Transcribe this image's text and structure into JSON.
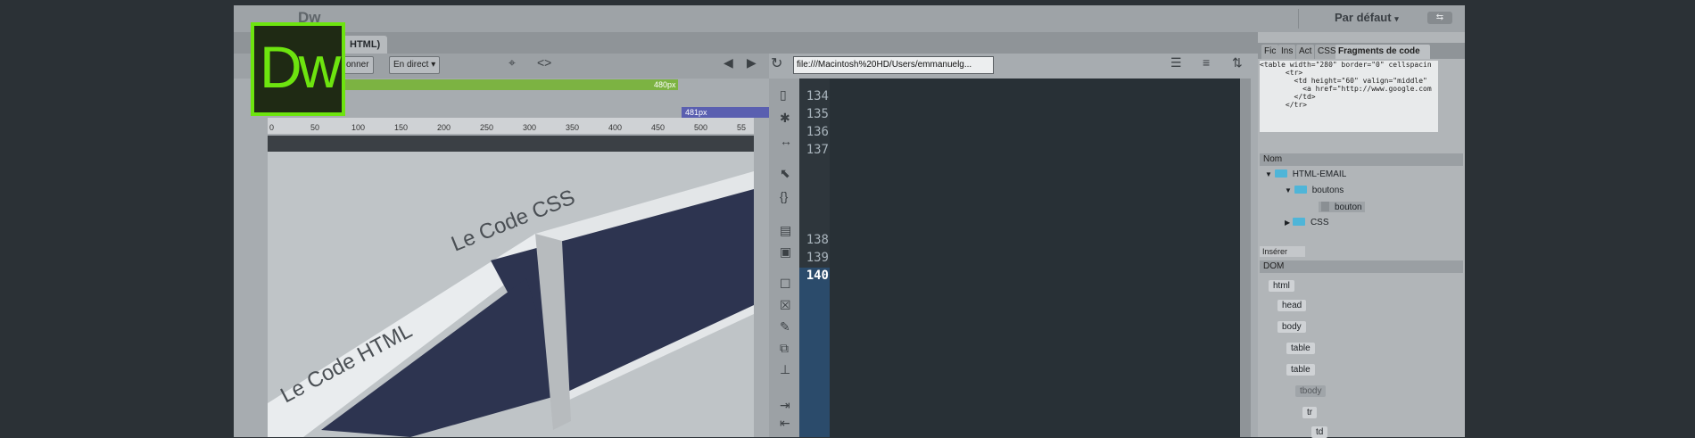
{
  "app": {
    "title": "Dw",
    "workspace": "Par défaut",
    "logo_text": "Dw"
  },
  "document": {
    "tab_label": "HTML)",
    "url": "file:///Macintosh%20HD/Users/emmanuelg...",
    "toolbar_btn1": "onner",
    "toolbar_btn2": "En direct"
  },
  "design_view": {
    "media_queries": [
      "480px",
      "481px"
    ],
    "ruler_ticks": [
      "0",
      "50",
      "100",
      "150",
      "200",
      "250",
      "300",
      "350",
      "400",
      "450",
      "500",
      "55"
    ]
  },
  "code_view": {
    "line_numbers": [
      "134",
      "135",
      "136",
      "137",
      "138",
      "139",
      "140"
    ],
    "current_line": "140"
  },
  "right_panel": {
    "tabs": [
      "Fic",
      "Ins",
      "Act",
      "CSS",
      "Fragments de code"
    ],
    "snippet_preview": "<table width=\"280\" border=\"0\" cellspacin\n      <tr>\n        <td height=\"60\" valign=\"middle\"\n          <a href=\"http://www.google.com\n        </td>\n      </tr>",
    "name_header": "Nom",
    "tree": [
      "HTML-EMAIL",
      "boutons",
      "bouton",
      "CSS"
    ],
    "insert_label": "Insérer",
    "dom_header": "DOM",
    "dom_nodes": [
      "html",
      "head",
      "body",
      "table",
      "table",
      "tbody",
      "tr",
      "td"
    ]
  },
  "colors": {
    "logo_green": "#6de40f",
    "code_bg": "#283036",
    "string_color": "#f0c47a",
    "value_color": "#e07a5f"
  }
}
